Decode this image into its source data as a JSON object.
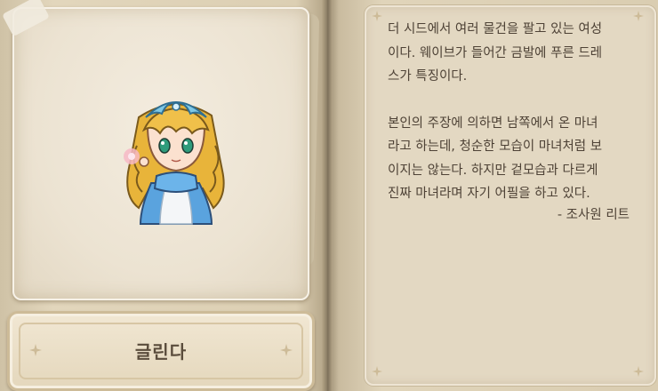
{
  "character": {
    "name": "글린다",
    "description_lines": [
      "더 시드에서 여러 물건을 팔고 있는 여성",
      "이다. 웨이브가 들어간 금발에 푸른 드레",
      "스가 특징이다."
    ],
    "description_lines_2": [
      "본인의 주장에 의하면 남쪽에서 온 마녀",
      "라고 하는데, 청순한 모습이 마녀처럼 보",
      "이지는 않는다. 하지만 겉모습과 다르게",
      "진짜 마녀라며 자기 어필을 하고 있다."
    ],
    "signature": "- 조사원 리트"
  }
}
